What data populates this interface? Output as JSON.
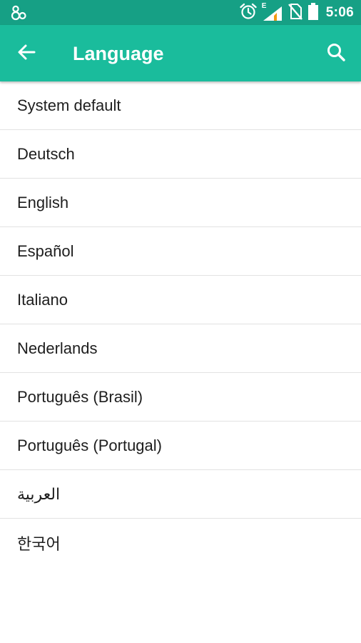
{
  "status_bar": {
    "time": "5:06",
    "network_type": "E",
    "icons": [
      "app-notification-icon",
      "alarm-icon",
      "signal-icon",
      "no-sim-icon",
      "battery-icon"
    ]
  },
  "app_bar": {
    "title": "Language",
    "back_icon": "arrow-left-icon",
    "search_icon": "search-icon",
    "background": "#1abc9c",
    "status_background": "#16a085"
  },
  "languages": [
    {
      "label": "System default"
    },
    {
      "label": "Deutsch"
    },
    {
      "label": "English"
    },
    {
      "label": "Español"
    },
    {
      "label": "Italiano"
    },
    {
      "label": "Nederlands"
    },
    {
      "label": "Português (Brasil)"
    },
    {
      "label": "Português (Portugal)"
    },
    {
      "label": "العربية"
    },
    {
      "label": "한국어"
    }
  ]
}
